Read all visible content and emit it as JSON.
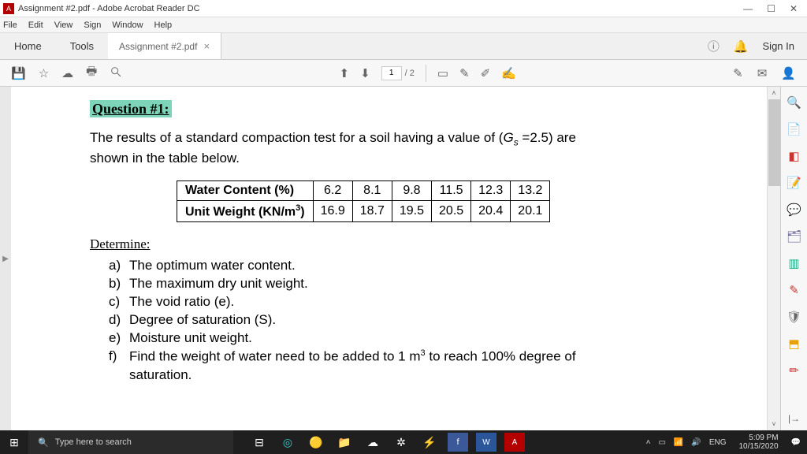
{
  "window": {
    "title": "Assignment #2.pdf - Adobe Acrobat Reader DC"
  },
  "menu": {
    "file": "File",
    "edit": "Edit",
    "view": "View",
    "sign": "Sign",
    "window": "Window",
    "help": "Help"
  },
  "tabs": {
    "home": "Home",
    "tools": "Tools",
    "doc": "Assignment #2.pdf",
    "signin": "Sign In"
  },
  "toolbar": {
    "page_current": "1",
    "page_total": "/ 2"
  },
  "doc": {
    "question_label": "Question #1:",
    "intro_a": "The results of a standard compaction test for a soil having a value of (",
    "intro_gs": "G",
    "intro_s": "s",
    "intro_eq": " =2.5) are",
    "intro_b": "shown in the table below.",
    "row1_label": "Water Content (%)",
    "row2_label": "Unit Weight (KN/m",
    "row2_sup": "3",
    "row2_close": ")",
    "determine": "Determine:",
    "items": {
      "a": "The optimum water content.",
      "b": "The maximum dry unit weight.",
      "c": "The void ratio (e).",
      "d": "Degree of saturation (S).",
      "e": "Moisture unit weight.",
      "f_a": "Find the weight of water need to be added to 1 m",
      "f_sup": "3",
      "f_b": " to reach 100% degree of",
      "f_c": "saturation."
    }
  },
  "chart_data": {
    "type": "table",
    "title": "Standard compaction test results",
    "rows": [
      {
        "label": "Water Content (%)",
        "values": [
          6.2,
          8.1,
          9.8,
          11.5,
          12.3,
          13.2
        ]
      },
      {
        "label": "Unit Weight (KN/m³)",
        "values": [
          16.9,
          18.7,
          19.5,
          20.5,
          20.4,
          20.1
        ]
      }
    ]
  },
  "taskbar": {
    "search_placeholder": "Type here to search",
    "lang": "ENG",
    "time": "5:09 PM",
    "date": "10/15/2020"
  }
}
